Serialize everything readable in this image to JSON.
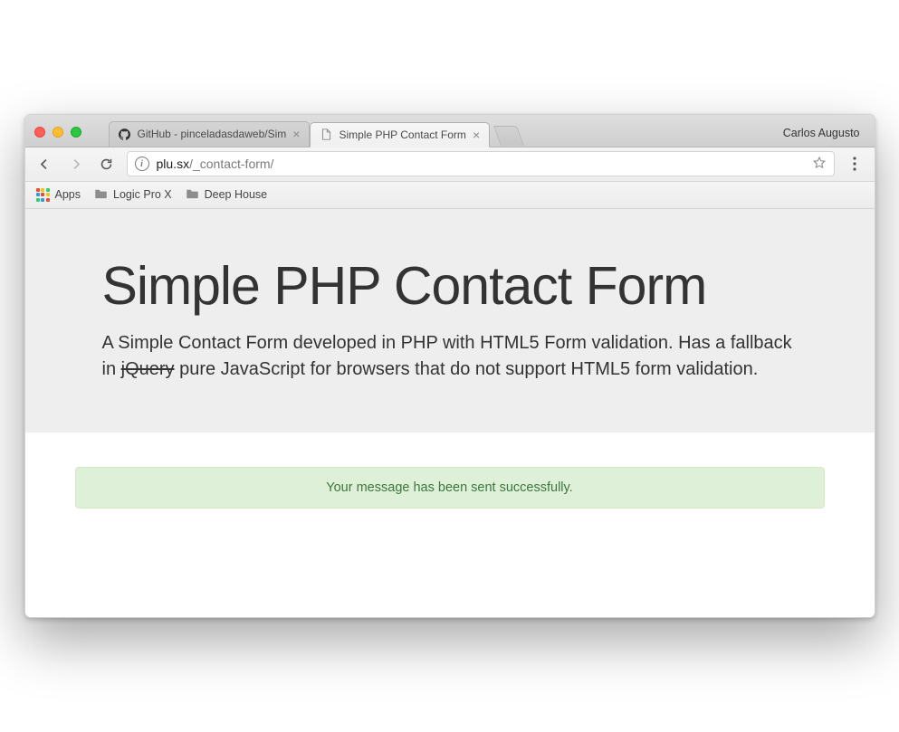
{
  "window": {
    "traffic": [
      "red",
      "yellow",
      "green"
    ],
    "profile_name": "Carlos Augusto"
  },
  "tabs": [
    {
      "title": "GitHub - pinceladasdaweb/Sim",
      "active": false,
      "favicon": "github"
    },
    {
      "title": "Simple PHP Contact Form",
      "active": true,
      "favicon": "page"
    }
  ],
  "toolbar": {
    "back_enabled": true,
    "forward_enabled": false,
    "address_host": "plu.sx",
    "address_path": "/_contact-form/"
  },
  "bookmarks": {
    "apps_label": "Apps",
    "items": [
      "Logic Pro X",
      "Deep House"
    ]
  },
  "content": {
    "heading": "Simple PHP Contact Form",
    "desc_pre": "A Simple Contact Form developed in PHP with HTML5 Form validation. Has a fallback in ",
    "desc_strike": "jQuery",
    "desc_post": " pure JavaScript for browsers that do not support HTML5 form validation.",
    "alert": "Your message has been sent successfully."
  }
}
